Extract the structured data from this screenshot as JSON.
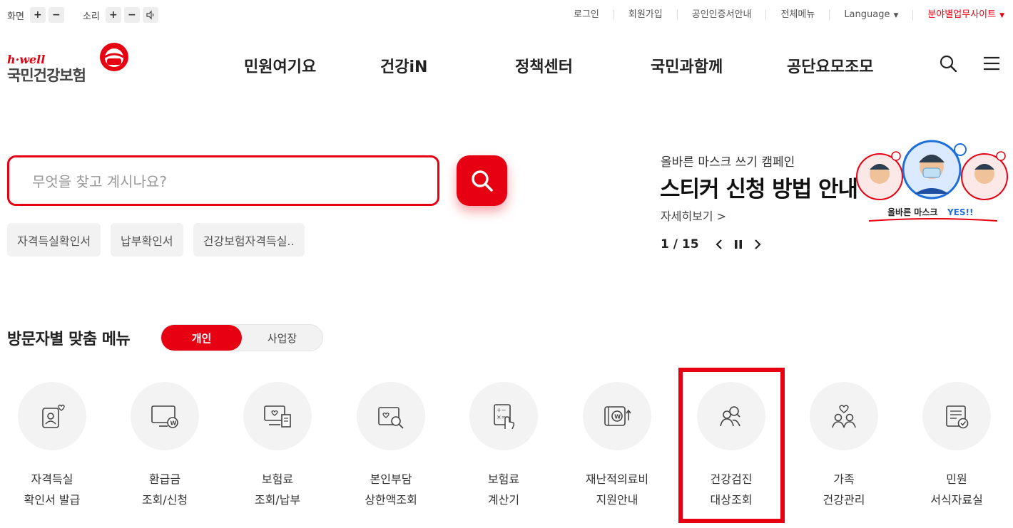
{
  "utility": {
    "screen_label": "화면",
    "sound_label": "소리",
    "plus": "+",
    "minus": "−",
    "links": [
      "로그인",
      "회원가입",
      "공인인증서안내",
      "전체메뉴"
    ],
    "language": "Language",
    "field_site": "분야별업무사이트"
  },
  "logo": {
    "hwell": "h·well",
    "name": "국민건강보험"
  },
  "gnb": [
    "민원여기요",
    "건강iN",
    "정책센터",
    "국민과함께",
    "공단요모조모"
  ],
  "search": {
    "placeholder": "무엇을 찾고 계시나요?",
    "tags": [
      "자격득실확인서",
      "납부확인서",
      "건강보험자격득실.."
    ]
  },
  "banner": {
    "subtitle": "올바른 마스크 쓰기 캠페인",
    "title": "스티커 신청 방법 안내",
    "more": "자세히보기 >",
    "pager": "1 / 15",
    "art_caption_a": "올바른 마스크 ",
    "art_caption_b": "YES!!"
  },
  "custom_menu": {
    "title": "방문자별 맞춤 메뉴",
    "toggle_on": "개인",
    "toggle_off": "사업장",
    "items": [
      {
        "line1": "자격득실",
        "line2": "확인서 발급",
        "icon": "id-card-heart-icon"
      },
      {
        "line1": "환급금",
        "line2": "조회/신청",
        "icon": "monitor-won-icon"
      },
      {
        "line1": "보험료",
        "line2": "조회/납부",
        "icon": "computer-receipt-icon"
      },
      {
        "line1": "본인부담",
        "line2": "상한액조회",
        "icon": "document-search-icon"
      },
      {
        "line1": "보험료",
        "line2": "계산기",
        "icon": "calculator-hand-icon"
      },
      {
        "line1": "재난적의료비",
        "line2": "지원안내",
        "icon": "wallet-won-icon"
      },
      {
        "line1": "건강검진",
        "line2": "대상조회",
        "icon": "people-search-icon"
      },
      {
        "line1": "가족",
        "line2": "건강관리",
        "icon": "family-heart-icon"
      },
      {
        "line1": "민원",
        "line2": "서식자료실",
        "icon": "form-check-icon"
      }
    ]
  },
  "colors": {
    "accent": "#e60012",
    "text": "#222222",
    "chip_bg": "#f2f2f2"
  }
}
